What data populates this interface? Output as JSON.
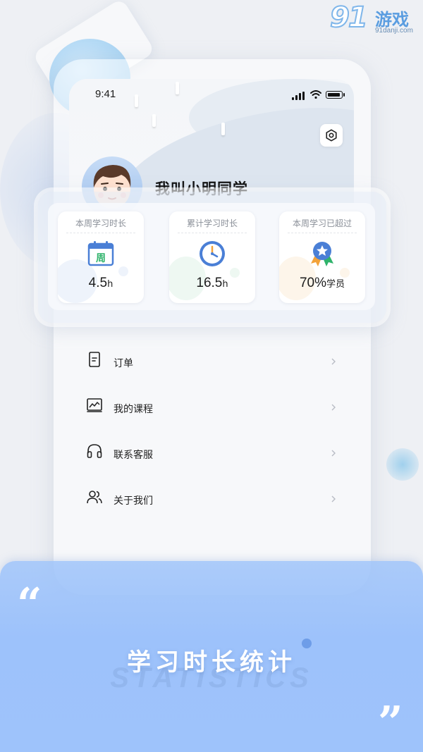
{
  "watermark": {
    "logo_num": "91",
    "logo_text": "游戏",
    "url": "91danji.com"
  },
  "status_bar": {
    "time": "9:41"
  },
  "profile": {
    "username": "我叫小明同学"
  },
  "stats": [
    {
      "label": "本周学习时长",
      "value": "4.5",
      "unit": "h",
      "icon": "calendar-week-icon",
      "badge_char": "周"
    },
    {
      "label": "累计学习时长",
      "value": "16.5",
      "unit": "h",
      "icon": "clock-icon"
    },
    {
      "label": "本周学习已超过",
      "value": "70%",
      "unit": "学员",
      "icon": "award-medal-icon"
    }
  ],
  "menu": [
    {
      "label": "订单",
      "icon": "order-document-icon"
    },
    {
      "label": "我的课程",
      "icon": "course-chart-icon"
    },
    {
      "label": "联系客服",
      "icon": "headset-icon"
    },
    {
      "label": "关于我们",
      "icon": "users-icon"
    }
  ],
  "banner": {
    "title": "学习时长统计",
    "subtitle": "STATISTICS",
    "quote_open": "“",
    "quote_close": "”"
  },
  "colors": {
    "accent": "#4a7fd6",
    "banner": "#9dc2fb",
    "green": "#2fb36b",
    "orange": "#f2a23a"
  }
}
